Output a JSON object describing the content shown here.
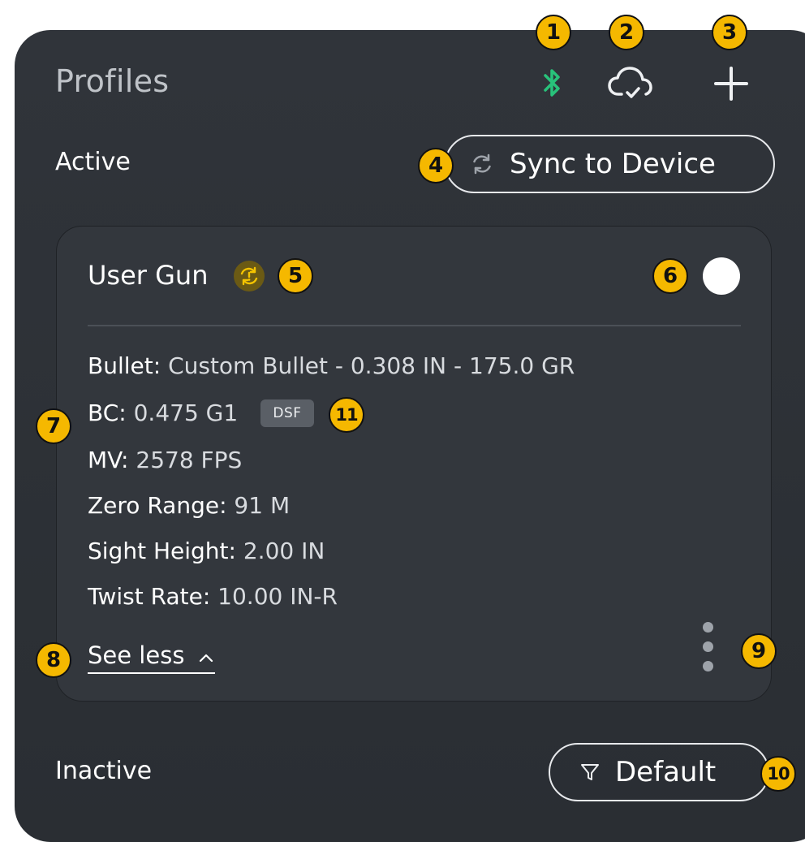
{
  "header": {
    "title": "Profiles"
  },
  "sections": {
    "active_label": "Active",
    "inactive_label": "Inactive"
  },
  "actions": {
    "sync_label": "Sync to Device",
    "filter_label": "Default"
  },
  "profile": {
    "name": "User Gun",
    "specs": [
      {
        "label": "Bullet:",
        "value": "Custom Bullet - 0.308 IN - 175.0 GR"
      },
      {
        "label": "BC:",
        "value": "0.475 G1"
      },
      {
        "label": "MV:",
        "value": "2578 FPS"
      },
      {
        "label": "Zero Range:",
        "value": "91 M"
      },
      {
        "label": "Sight Height:",
        "value": "2.00 IN"
      },
      {
        "label": "Twist Rate:",
        "value": "10.00 IN-R"
      }
    ],
    "bc_tag": "DSF",
    "toggle_label": "See less"
  },
  "callouts": [
    "1",
    "2",
    "3",
    "4",
    "5",
    "6",
    "7",
    "8",
    "9",
    "10",
    "11"
  ],
  "colors": {
    "panel": "#2e3237",
    "card": "#33373d",
    "bluetooth": "#28c27a",
    "callout": "#f5b800",
    "warning": "#6b5a14"
  },
  "icons": {
    "bluetooth": "bluetooth-icon",
    "cloud": "cloud-check-icon",
    "add": "plus-icon",
    "sync": "sync-icon",
    "warning": "sync-warning-icon",
    "filter": "filter-icon",
    "more": "kebab-menu-icon",
    "chevron": "chevron-up-icon"
  }
}
